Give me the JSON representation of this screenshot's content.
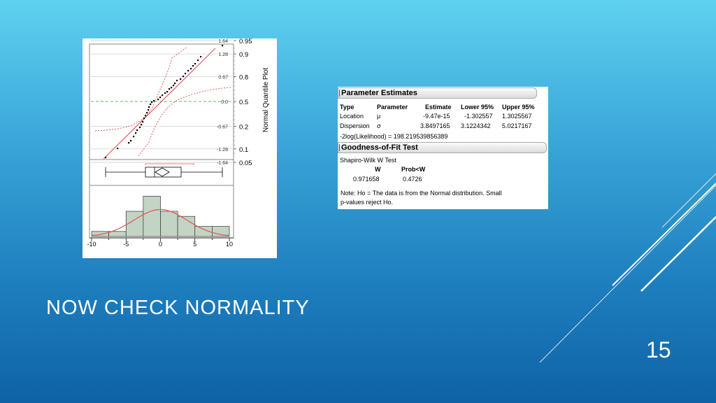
{
  "slide": {
    "title": "NOW CHECK NORMALITY",
    "page_number": "15"
  },
  "chart_data": [
    {
      "type": "scatter",
      "title": "",
      "axis_label": "Normal Quantile Plot",
      "left_ticks": [
        "1.64",
        "1.28",
        "0.67",
        "0.0",
        "-0.67",
        "-1.28",
        "-1.64"
      ],
      "right_ticks": [
        "0.95",
        "0.9",
        "0.8",
        "0.5",
        "0.2",
        "0.1",
        "0.05"
      ],
      "grid": true
    },
    {
      "type": "boxplot",
      "title": ""
    },
    {
      "type": "bar",
      "title": "",
      "categories": [
        "-10",
        "-7.5",
        "-5",
        "-2.5",
        "0",
        "2.5",
        "5",
        "7.5"
      ],
      "values": [
        1,
        1,
        5,
        8,
        5,
        4,
        2,
        2
      ],
      "x_ticks": [
        "-10",
        "-5",
        "0",
        "5",
        "10"
      ],
      "xlim": [
        -10,
        10
      ],
      "overlay": "normal density curve"
    }
  ],
  "report": {
    "param_title": "Parameter Estimates",
    "headers": [
      "Type",
      "Parameter",
      "Estimate",
      "Lower 95%",
      "Upper 95%"
    ],
    "rows": [
      [
        "Location",
        "μ",
        "-9.47e-15",
        "-1.302557",
        "1.3025567"
      ],
      [
        "Dispersion",
        "σ",
        "3.8497165",
        "3.1224342",
        "5.0217167"
      ]
    ],
    "likelihood": "-2log(Likelihood) = 198.219539856389",
    "gof_title": "Goodness-of-Fit Test",
    "test_name": "Shapiro-Wilk W Test",
    "w_header": "W",
    "p_header": "Prob<W",
    "w_value": "0.971658",
    "p_value": "0.4726",
    "note_line1": "Note: Ho = The data is from the Normal distribution. Small",
    "note_line2": "p-values reject Ho."
  },
  "colors": {
    "fit_line": "#e05a5a",
    "mean_line": "#5cb85c",
    "bar_fill": "#c4d4c4",
    "bar_stroke": "#333333"
  }
}
